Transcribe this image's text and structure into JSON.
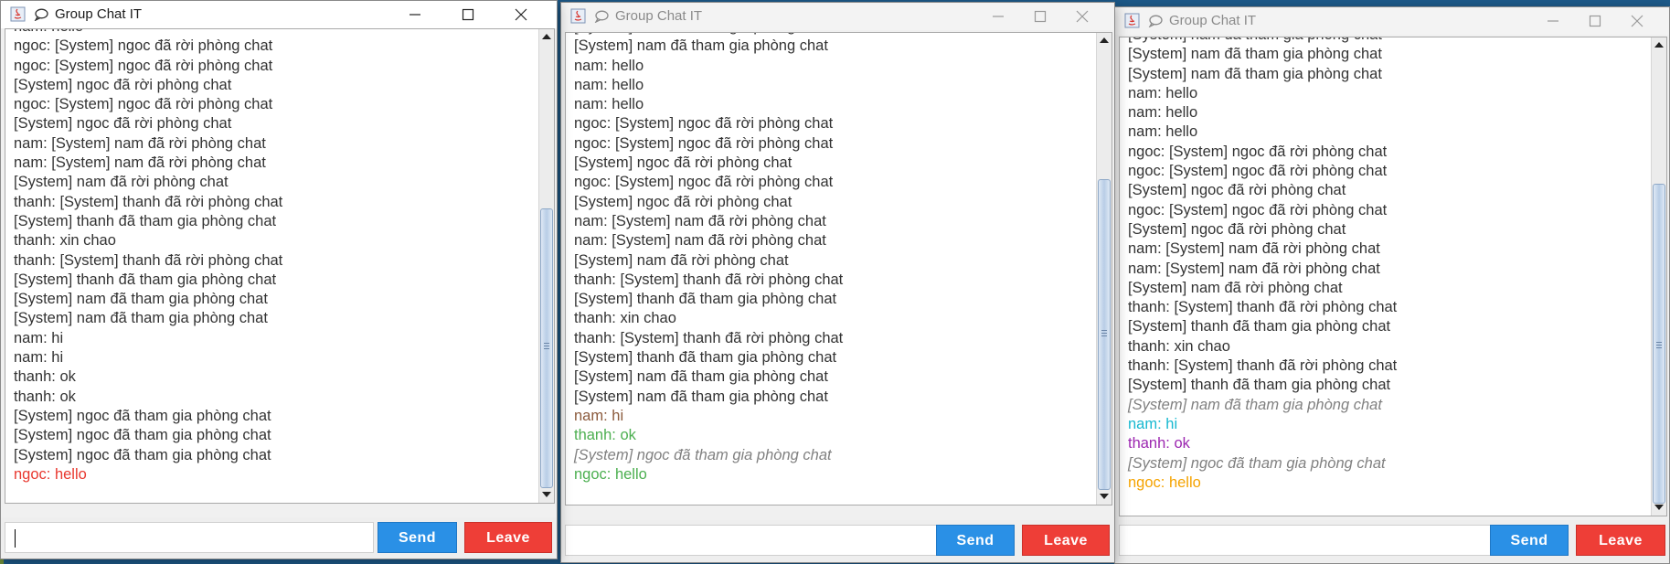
{
  "windows": [
    {
      "title": "Group Chat IT",
      "send_label": "Send",
      "leave_label": "Leave",
      "input_value": "",
      "lines": [
        {
          "text": "nam: hello",
          "color": "#333333",
          "italic": false
        },
        {
          "text": "ngoc: [System] ngoc đã rời phòng chat",
          "color": "#333333",
          "italic": false
        },
        {
          "text": "ngoc: [System] ngoc đã rời phòng chat",
          "color": "#333333",
          "italic": false
        },
        {
          "text": "[System] ngoc đã rời phòng chat",
          "color": "#333333",
          "italic": false
        },
        {
          "text": "ngoc: [System] ngoc đã rời phòng chat",
          "color": "#333333",
          "italic": false
        },
        {
          "text": "[System] ngoc đã rời phòng chat",
          "color": "#333333",
          "italic": false
        },
        {
          "text": "nam: [System] nam đã rời phòng chat",
          "color": "#333333",
          "italic": false
        },
        {
          "text": "nam: [System] nam đã rời phòng chat",
          "color": "#333333",
          "italic": false
        },
        {
          "text": "[System] nam đã rời phòng chat",
          "color": "#333333",
          "italic": false
        },
        {
          "text": "thanh: [System] thanh đã rời phòng chat",
          "color": "#333333",
          "italic": false
        },
        {
          "text": "[System] thanh đã tham gia phòng chat",
          "color": "#333333",
          "italic": false
        },
        {
          "text": "thanh: xin chao",
          "color": "#333333",
          "italic": false
        },
        {
          "text": "thanh: [System] thanh đã rời phòng chat",
          "color": "#333333",
          "italic": false
        },
        {
          "text": "[System] thanh đã tham gia phòng chat",
          "color": "#333333",
          "italic": false
        },
        {
          "text": "[System] nam đã tham gia phòng chat",
          "color": "#333333",
          "italic": false
        },
        {
          "text": "[System] nam đã tham gia phòng chat",
          "color": "#333333",
          "italic": false
        },
        {
          "text": "nam: hi",
          "color": "#333333",
          "italic": false
        },
        {
          "text": "nam: hi",
          "color": "#333333",
          "italic": false
        },
        {
          "text": "thanh: ok",
          "color": "#333333",
          "italic": false
        },
        {
          "text": "thanh: ok",
          "color": "#333333",
          "italic": false
        },
        {
          "text": "[System] ngoc đã tham gia phòng chat",
          "color": "#333333",
          "italic": false
        },
        {
          "text": "[System] ngoc đã tham gia phòng chat",
          "color": "#333333",
          "italic": false
        },
        {
          "text": "[System] ngoc đã tham gia phòng chat",
          "color": "#333333",
          "italic": false
        },
        {
          "text": "ngoc: hello",
          "color": "#e8382f",
          "italic": false
        }
      ]
    },
    {
      "title": "Group Chat IT",
      "send_label": "Send",
      "leave_label": "Leave",
      "input_value": "",
      "lines": [
        {
          "text": "[System] nam đã tham gia phòng chat",
          "color": "#333333",
          "italic": false
        },
        {
          "text": "[System] nam đã tham gia phòng chat",
          "color": "#333333",
          "italic": false
        },
        {
          "text": "nam: hello",
          "color": "#333333",
          "italic": false
        },
        {
          "text": "nam: hello",
          "color": "#333333",
          "italic": false
        },
        {
          "text": "nam: hello",
          "color": "#333333",
          "italic": false
        },
        {
          "text": "ngoc: [System] ngoc đã rời phòng chat",
          "color": "#333333",
          "italic": false
        },
        {
          "text": "ngoc: [System] ngoc đã rời phòng chat",
          "color": "#333333",
          "italic": false
        },
        {
          "text": "[System] ngoc đã rời phòng chat",
          "color": "#333333",
          "italic": false
        },
        {
          "text": "ngoc: [System] ngoc đã rời phòng chat",
          "color": "#333333",
          "italic": false
        },
        {
          "text": "[System] ngoc đã rời phòng chat",
          "color": "#333333",
          "italic": false
        },
        {
          "text": "nam: [System] nam đã rời phòng chat",
          "color": "#333333",
          "italic": false
        },
        {
          "text": "nam: [System] nam đã rời phòng chat",
          "color": "#333333",
          "italic": false
        },
        {
          "text": "[System] nam đã rời phòng chat",
          "color": "#333333",
          "italic": false
        },
        {
          "text": "thanh: [System] thanh đã rời phòng chat",
          "color": "#333333",
          "italic": false
        },
        {
          "text": "[System] thanh đã tham gia phòng chat",
          "color": "#333333",
          "italic": false
        },
        {
          "text": "thanh: xin chao",
          "color": "#333333",
          "italic": false
        },
        {
          "text": "thanh: [System] thanh đã rời phòng chat",
          "color": "#333333",
          "italic": false
        },
        {
          "text": "[System] thanh đã tham gia phòng chat",
          "color": "#333333",
          "italic": false
        },
        {
          "text": "[System] nam đã tham gia phòng chat",
          "color": "#333333",
          "italic": false
        },
        {
          "text": "[System] nam đã tham gia phòng chat",
          "color": "#333333",
          "italic": false
        },
        {
          "text": "nam: hi",
          "color": "#8b5a3c",
          "italic": false
        },
        {
          "text": "thanh: ok",
          "color": "#4caf50",
          "italic": false
        },
        {
          "text": "[System] ngoc đã tham gia phòng chat",
          "color": "#808080",
          "italic": true
        },
        {
          "text": "ngoc: hello",
          "color": "#4caf50",
          "italic": false
        }
      ]
    },
    {
      "title": "Group Chat IT",
      "send_label": "Send",
      "leave_label": "Leave",
      "input_value": "",
      "lines": [
        {
          "text": "[System] nam đã tham gia phòng chat",
          "color": "#333333",
          "italic": false
        },
        {
          "text": "[System] nam đã tham gia phòng chat",
          "color": "#333333",
          "italic": false
        },
        {
          "text": "[System] nam đã tham gia phòng chat",
          "color": "#333333",
          "italic": false
        },
        {
          "text": "nam: hello",
          "color": "#333333",
          "italic": false
        },
        {
          "text": "nam: hello",
          "color": "#333333",
          "italic": false
        },
        {
          "text": "nam: hello",
          "color": "#333333",
          "italic": false
        },
        {
          "text": "ngoc: [System] ngoc đã rời phòng chat",
          "color": "#333333",
          "italic": false
        },
        {
          "text": "ngoc: [System] ngoc đã rời phòng chat",
          "color": "#333333",
          "italic": false
        },
        {
          "text": "[System] ngoc đã rời phòng chat",
          "color": "#333333",
          "italic": false
        },
        {
          "text": "ngoc: [System] ngoc đã rời phòng chat",
          "color": "#333333",
          "italic": false
        },
        {
          "text": "[System] ngoc đã rời phòng chat",
          "color": "#333333",
          "italic": false
        },
        {
          "text": "nam: [System] nam đã rời phòng chat",
          "color": "#333333",
          "italic": false
        },
        {
          "text": "nam: [System] nam đã rời phòng chat",
          "color": "#333333",
          "italic": false
        },
        {
          "text": "[System] nam đã rời phòng chat",
          "color": "#333333",
          "italic": false
        },
        {
          "text": "thanh: [System] thanh đã rời phòng chat",
          "color": "#333333",
          "italic": false
        },
        {
          "text": "[System] thanh đã tham gia phòng chat",
          "color": "#333333",
          "italic": false
        },
        {
          "text": "thanh: xin chao",
          "color": "#333333",
          "italic": false
        },
        {
          "text": "thanh: [System] thanh đã rời phòng chat",
          "color": "#333333",
          "italic": false
        },
        {
          "text": "[System] thanh đã tham gia phòng chat",
          "color": "#333333",
          "italic": false
        },
        {
          "text": "[System] nam đã tham gia phòng chat",
          "color": "#808080",
          "italic": true
        },
        {
          "text": "nam: hi",
          "color": "#17b8d0",
          "italic": false
        },
        {
          "text": "thanh: ok",
          "color": "#9c27b0",
          "italic": false
        },
        {
          "text": "[System] ngoc đã tham gia phòng chat",
          "color": "#808080",
          "italic": true
        },
        {
          "text": "ngoc: hello",
          "color": "#f5a300",
          "italic": false
        }
      ]
    }
  ]
}
